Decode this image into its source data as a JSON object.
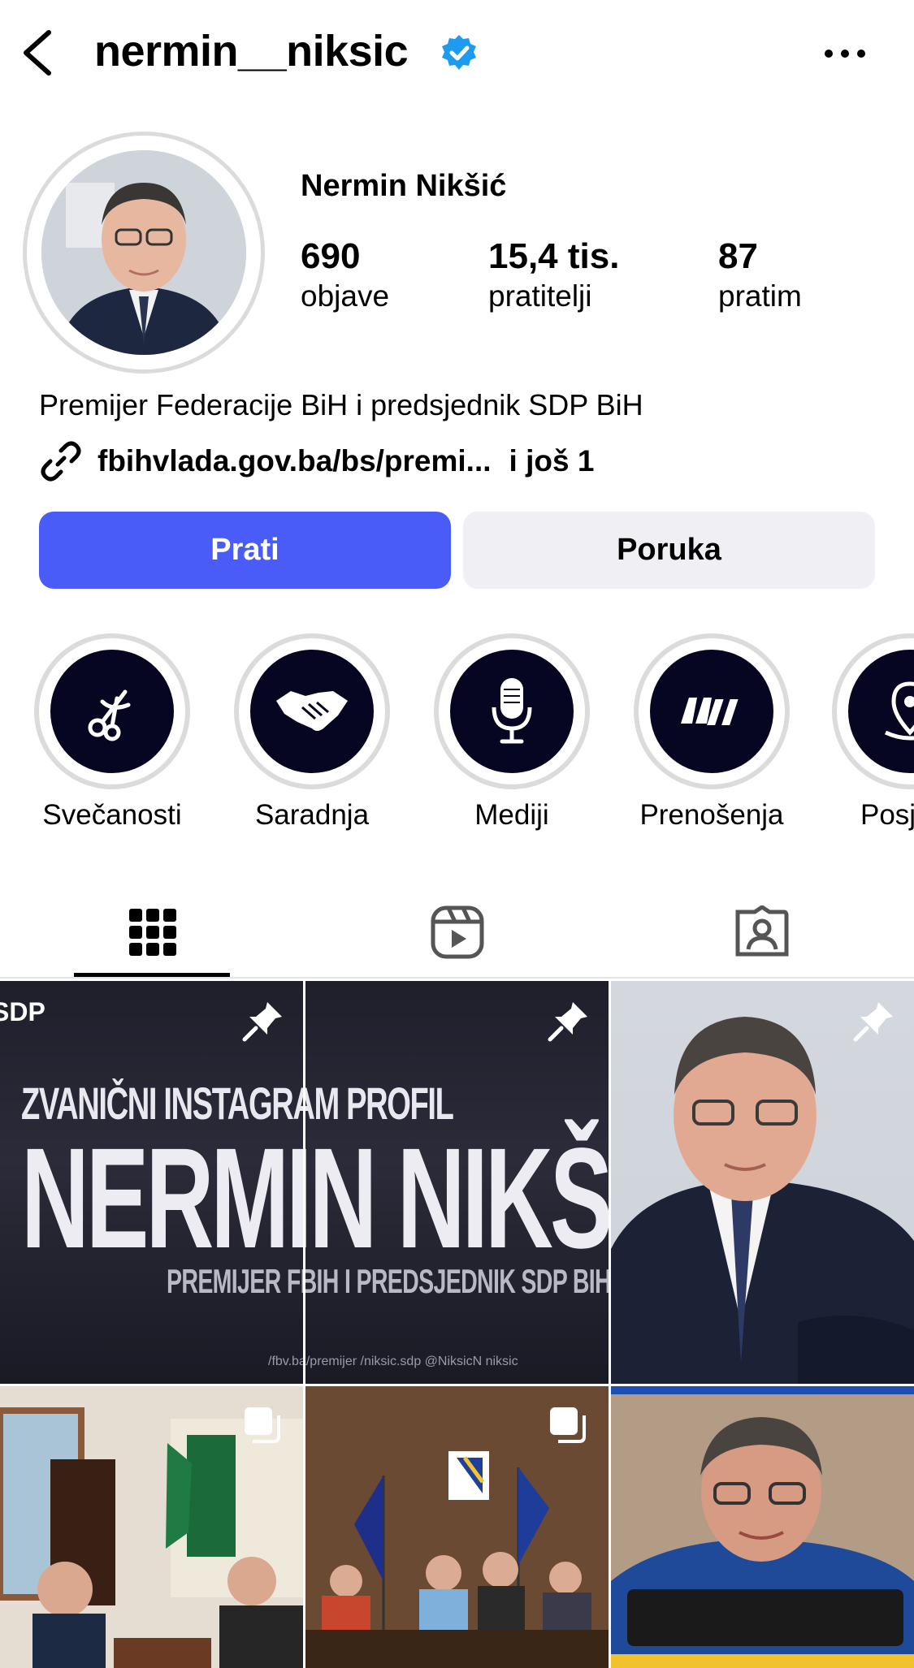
{
  "header": {
    "username": "nermin__niksic",
    "verified": true,
    "back_icon": "chevron-left-icon",
    "more_icon": "more-horizontal-icon"
  },
  "profile": {
    "display_name": "Nermin Nikšić",
    "stats": [
      {
        "value": "690",
        "label": "objave"
      },
      {
        "value": "15,4 tis.",
        "label": "pratitelji"
      },
      {
        "value": "87",
        "label": "pratim"
      }
    ],
    "bio": "Premijer Federacije BiH i predsjednik SDP BiH",
    "link": {
      "text": "fbihvlada.gov.ba/bs/premi...",
      "more": "i još 1",
      "icon": "link-icon"
    }
  },
  "actions": {
    "follow_label": "Prati",
    "message_label": "Poruka"
  },
  "highlights": [
    {
      "label": "Svečanosti",
      "icon": "ribbon-scissors-icon"
    },
    {
      "label": "Saradnja",
      "icon": "handshake-icon"
    },
    {
      "label": "Mediji",
      "icon": "microphone-icon"
    },
    {
      "label": "Prenošenja",
      "icon": "quote-icon"
    },
    {
      "label": "Posj",
      "icon": "location-pin-icon"
    }
  ],
  "tabs": [
    {
      "name": "posts",
      "icon": "grid-icon",
      "active": true
    },
    {
      "name": "reels",
      "icon": "reels-icon",
      "active": false
    },
    {
      "name": "tagged",
      "icon": "tagged-icon",
      "active": false
    }
  ],
  "grid": {
    "banner": {
      "logo": "SDP",
      "line1": "ZVANIČNI INSTAGRAM PROFIL",
      "line2": "NERMIN NIKŠIĆ",
      "line3": "PREMIJER FBIH I PREDSJEDNIK SDP BIH",
      "social": "/fbv.ba/premijer    /niksic.sdp    @NiksicN    niksic"
    }
  },
  "colors": {
    "follow_button": "#4a5cf8",
    "message_button": "#efeff4",
    "verified_badge": "#1d9bf0",
    "highlight_bg": "#060622"
  }
}
